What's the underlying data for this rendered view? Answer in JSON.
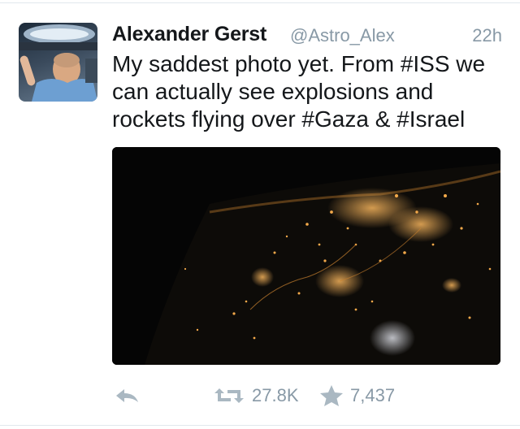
{
  "tweet": {
    "author_name": "Alexander Gerst",
    "author_handle": "@Astro_Alex",
    "timestamp": "22h",
    "text_lines": [
      "My saddest photo yet. From #ISS we",
      "can actually see explosions and",
      "rockets flying over #Gaza & #Israel"
    ],
    "retweet_count": "27.8K",
    "favorite_count": "7,437"
  },
  "icons": {
    "reply": "reply-icon",
    "retweet": "retweet-icon",
    "favorite": "star-icon"
  },
  "colors": {
    "name": "#14171a",
    "secondary_text": "#8899a6",
    "photo_background": "#050505",
    "city_lights": "#f3a94a"
  }
}
